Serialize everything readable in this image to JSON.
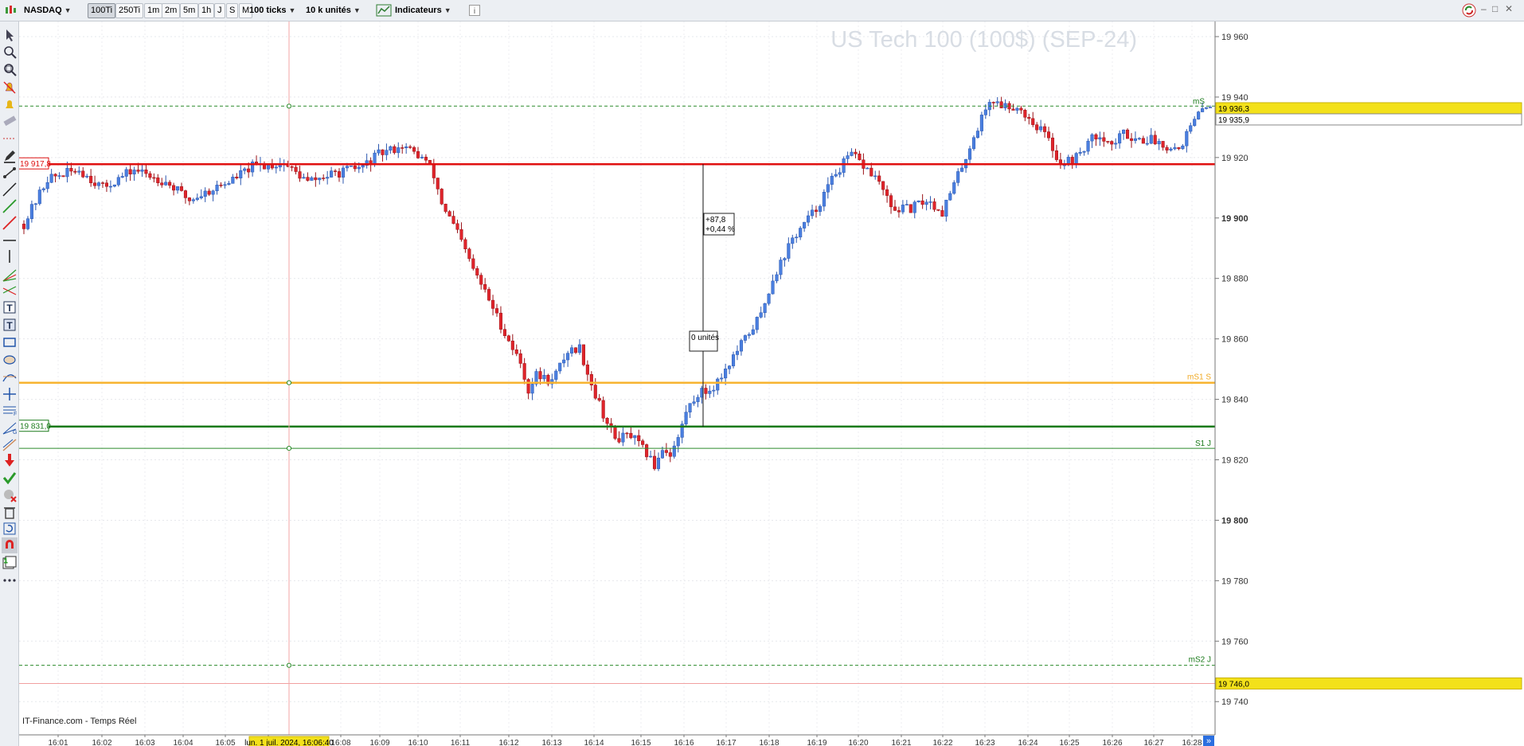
{
  "toolbar": {
    "symbol": "NASDAQ",
    "timeframes": [
      "100Ti",
      "250Ti",
      "1m",
      "2m",
      "5m",
      "1h",
      "J",
      "S",
      "M"
    ],
    "active_timeframe": "100Ti",
    "history_label": "100 ticks",
    "volume_label": "10 k unités",
    "indicators_label": "Indicateurs"
  },
  "watermark": "US Tech 100 (100$) (SEP-24)",
  "footer": "IT-Finance.com - Temps Réel",
  "measure": {
    "change": "+87,8",
    "percent": "+0,44 %",
    "units": "0 unités"
  },
  "cursor_time_label": "lun. 1 juil. 2024, 16:06:40",
  "price_tags": {
    "red_line": "19 917,8",
    "green_line": "19 831,0",
    "last_price": "19 936,3",
    "prev_price": "19 935,9",
    "bottom_line": "19 746,0"
  },
  "level_labels": {
    "ms1_s": "mS1 S",
    "s1_j": "S1 J",
    "ms2_j": "mS2 J",
    "ms_top": "mS"
  },
  "colors": {
    "up": "#4a7fe0",
    "down": "#e0242b",
    "red_line": "#e01010",
    "orange_line": "#f7b431",
    "green_line": "#1a7a1a",
    "tag_last": "#f3e11a"
  },
  "chart_data": {
    "type": "candlestick",
    "title": "US Tech 100 (100$) (SEP-24)",
    "y_ticks": [
      19960,
      19940,
      19920,
      19900,
      19880,
      19860,
      19840,
      19820,
      19800,
      19780,
      19760,
      19740
    ],
    "y_tick_labels": [
      "19 960",
      "19 940",
      "19 920",
      "19 900",
      "19 880",
      "19 860",
      "19 840",
      "19 820",
      "19 800",
      "19 780",
      "19 760",
      "19 740"
    ],
    "x_tick_labels": [
      "16:01",
      "16:02",
      "16:03",
      "16:04",
      "16:05",
      "16:06",
      "16:08",
      "16:09",
      "16:10",
      "16:11",
      "16:12",
      "16:13",
      "16:14",
      "16:15",
      "16:16",
      "16:17",
      "16:18",
      "16:19",
      "16:20",
      "16:21",
      "16:22",
      "16:23",
      "16:24",
      "16:25",
      "16:26",
      "16:27",
      "16:28"
    ],
    "ylim": [
      19729,
      19965
    ],
    "horizontal_levels": [
      {
        "name": "red_line",
        "value": 19917.8
      },
      {
        "name": "mS",
        "value": 19937
      },
      {
        "name": "mS1 S",
        "value": 19845.5
      },
      {
        "name": "green_line",
        "value": 19831.0
      },
      {
        "name": "S1 J",
        "value": 19823.8
      },
      {
        "name": "mS2 J",
        "value": 19752
      },
      {
        "name": "bottom_line",
        "value": 19746.0
      }
    ],
    "close_path": [
      [
        0,
        19898
      ],
      [
        6,
        19913
      ],
      [
        14,
        19916
      ],
      [
        20,
        19910
      ],
      [
        28,
        19916
      ],
      [
        36,
        19912
      ],
      [
        42,
        19906
      ],
      [
        52,
        19912
      ],
      [
        58,
        19917
      ],
      [
        66,
        19918
      ],
      [
        72,
        19912
      ],
      [
        80,
        19915
      ],
      [
        86,
        19917
      ],
      [
        90,
        19921
      ],
      [
        96,
        19924
      ],
      [
        102,
        19919
      ],
      [
        104,
        19914
      ],
      [
        106,
        19905
      ],
      [
        110,
        19895
      ],
      [
        114,
        19883
      ],
      [
        118,
        19873
      ],
      [
        122,
        19862
      ],
      [
        126,
        19852
      ],
      [
        128,
        19843
      ],
      [
        130,
        19848
      ],
      [
        134,
        19846
      ],
      [
        138,
        19856
      ],
      [
        141,
        19857
      ],
      [
        144,
        19845
      ],
      [
        148,
        19832
      ],
      [
        150,
        19827
      ],
      [
        154,
        19828
      ],
      [
        158,
        19822
      ],
      [
        160,
        19818
      ],
      [
        162,
        19824
      ],
      [
        164,
        19822
      ],
      [
        166,
        19827
      ],
      [
        168,
        19836
      ],
      [
        171,
        19842
      ],
      [
        174,
        19843
      ],
      [
        176,
        19846
      ],
      [
        179,
        19852
      ],
      [
        183,
        19860
      ],
      [
        187,
        19868
      ],
      [
        190,
        19880
      ],
      [
        195,
        19893
      ],
      [
        201,
        19903
      ],
      [
        206,
        19915
      ],
      [
        210,
        19921
      ],
      [
        214,
        19916
      ],
      [
        217,
        19912
      ],
      [
        220,
        19903
      ],
      [
        225,
        19903
      ],
      [
        229,
        19906
      ],
      [
        233,
        19902
      ],
      [
        237,
        19914
      ],
      [
        242,
        19930
      ],
      [
        245,
        19939
      ],
      [
        249,
        19937
      ],
      [
        252,
        19937
      ],
      [
        255,
        19933
      ],
      [
        259,
        19928
      ],
      [
        263,
        19918
      ],
      [
        267,
        19920
      ],
      [
        270,
        19925
      ],
      [
        273,
        19928
      ],
      [
        276,
        19924
      ],
      [
        279,
        19928
      ],
      [
        283,
        19926
      ],
      [
        286,
        19926
      ],
      [
        290,
        19924
      ],
      [
        293,
        19923
      ],
      [
        296,
        19930
      ],
      [
        299,
        19936
      ],
      [
        301,
        19938
      ]
    ],
    "highlighted_units": "0 unités",
    "grid": true
  }
}
